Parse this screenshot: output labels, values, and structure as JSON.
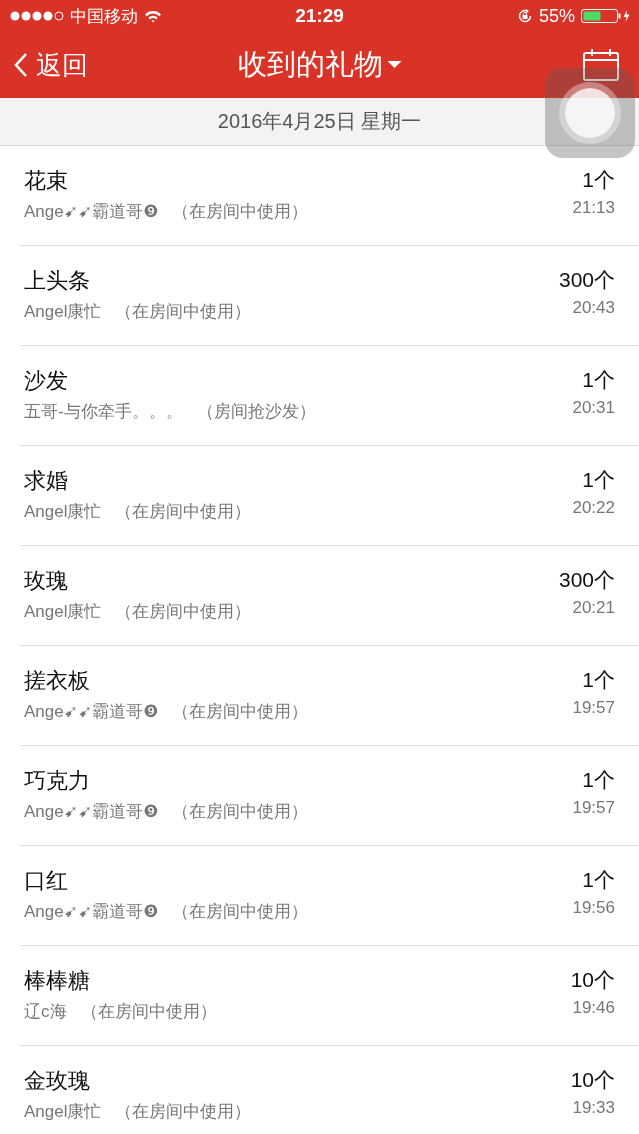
{
  "status_bar": {
    "carrier": "中国移动",
    "time": "21:29",
    "battery": "55%"
  },
  "nav_bar": {
    "back": "返回",
    "title": "收到的礼物"
  },
  "date_header": "2016年4月25日 星期一",
  "gifts": [
    {
      "name": "花束",
      "sender": "Ange➹➹霸道哥❾",
      "note": "（在房间中使用）",
      "count": "1个",
      "time": "21:13"
    },
    {
      "name": "上头条",
      "sender": "Angel康忙",
      "note": "（在房间中使用）",
      "count": "300个",
      "time": "20:43"
    },
    {
      "name": "沙发",
      "sender": "五哥-与你牵手。。。",
      "note": "（房间抢沙发）",
      "count": "1个",
      "time": "20:31"
    },
    {
      "name": "求婚",
      "sender": "Angel康忙",
      "note": "（在房间中使用）",
      "count": "1个",
      "time": "20:22"
    },
    {
      "name": "玫瑰",
      "sender": "Angel康忙",
      "note": "（在房间中使用）",
      "count": "300个",
      "time": "20:21"
    },
    {
      "name": "搓衣板",
      "sender": "Ange➹➹霸道哥❾",
      "note": "（在房间中使用）",
      "count": "1个",
      "time": "19:57"
    },
    {
      "name": "巧克力",
      "sender": "Ange➹➹霸道哥❾",
      "note": "（在房间中使用）",
      "count": "1个",
      "time": "19:57"
    },
    {
      "name": "口红",
      "sender": "Ange➹➹霸道哥❾",
      "note": "（在房间中使用）",
      "count": "1个",
      "time": "19:56"
    },
    {
      "name": "棒棒糖",
      "sender": "辽c海",
      "note": "（在房间中使用）",
      "count": "10个",
      "time": "19:46"
    },
    {
      "name": "金玫瑰",
      "sender": "Angel康忙",
      "note": "（在房间中使用）",
      "count": "10个",
      "time": "19:33"
    }
  ]
}
